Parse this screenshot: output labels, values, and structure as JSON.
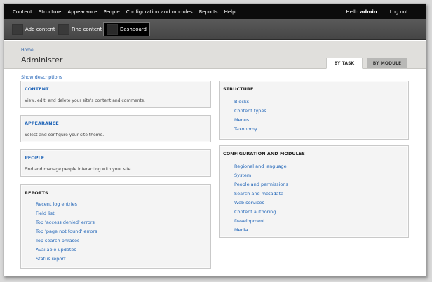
{
  "toolbar": {
    "menu": [
      "Content",
      "Structure",
      "Appearance",
      "People",
      "Configuration and modules",
      "Reports",
      "Help"
    ],
    "hello_prefix": "Hello ",
    "username": "admin",
    "logout": "Log out"
  },
  "shortcuts": {
    "add_content": "Add content",
    "find_content": "Find content",
    "dashboard": "Dashboard"
  },
  "header": {
    "breadcrumb": "Home",
    "title": "Administer",
    "tab_by_task": "BY TASK",
    "tab_by_module": "BY MODULE"
  },
  "show_descriptions": "Show descriptions",
  "left": {
    "content": {
      "title": "CONTENT",
      "desc": "View, edit, and delete your site's content and comments."
    },
    "appearance": {
      "title": "APPEARANCE",
      "desc": "Select and configure your site theme."
    },
    "people": {
      "title": "PEOPLE",
      "desc": "Find and manage people interacting with your site."
    },
    "reports": {
      "title": "REPORTS",
      "links": [
        "Recent log entries",
        "Field list",
        "Top 'access denied' errors",
        "Top 'page not found' errors",
        "Top search phrases",
        "Available updates",
        "Status report"
      ]
    }
  },
  "right": {
    "structure": {
      "title": "STRUCTURE",
      "links": [
        "Blocks",
        "Content types",
        "Menus",
        "Taxonomy"
      ]
    },
    "config": {
      "title": "CONFIGURATION AND MODULES",
      "links": [
        "Regional and language",
        "System",
        "People and permissions",
        "Search and metadata",
        "Web services",
        "Content authoring",
        "Development",
        "Media"
      ]
    }
  },
  "colors": {
    "link": "#2266b8",
    "toolbar": "#0c0c0c",
    "header_bg": "#e0dfdc"
  }
}
